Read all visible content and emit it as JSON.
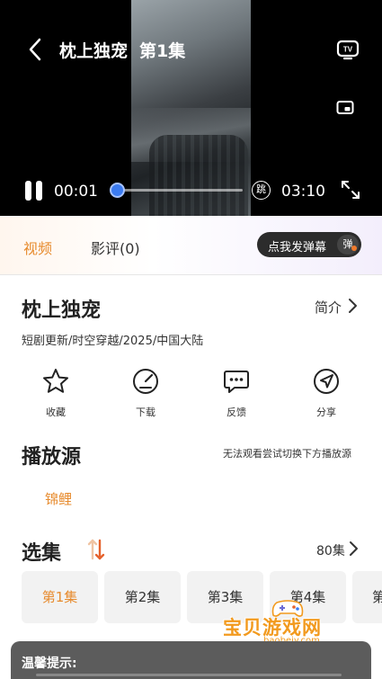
{
  "player": {
    "title": "枕上独宠",
    "episode": "第1集",
    "current_time": "00:01",
    "total_time": "03:10",
    "danmaku_toggle_glyph": "跳",
    "progress_fraction": 0.005,
    "icons": {
      "back": "back-arrow-icon",
      "tv_cast": "tv-cast-icon",
      "pip": "picture-in-picture-icon",
      "pause": "pause-icon",
      "fullscreen": "fullscreen-icon"
    }
  },
  "tabs": {
    "video": "视频",
    "review": "影评(0)",
    "danmaku_prompt": "点我发弹幕",
    "danmaku_badge": "弹"
  },
  "info": {
    "title": "枕上独宠",
    "intro_label": "简介",
    "meta": "短剧更新/时空穿越/2025/中国大陆"
  },
  "actions": [
    {
      "label": "收藏",
      "icon": "star-icon"
    },
    {
      "label": "下载",
      "icon": "download-icon"
    },
    {
      "label": "反馈",
      "icon": "feedback-icon"
    },
    {
      "label": "分享",
      "icon": "share-icon"
    }
  ],
  "source": {
    "title": "播放源",
    "hint": "无法观看尝试切换下方播放源",
    "selected": "锦鲤"
  },
  "episodes": {
    "title": "选集",
    "count_label": "80集",
    "items": [
      "第1集",
      "第2集",
      "第3集",
      "第4集",
      "第"
    ]
  },
  "warning": {
    "title": "温馨提示:"
  },
  "watermark": {
    "text": "宝贝游戏网",
    "sub": "baobeiy.com"
  },
  "colors": {
    "accent": "#e78b2e",
    "seek_knob": "#3b7bf0",
    "dark_pill": "#2c2c2c"
  }
}
